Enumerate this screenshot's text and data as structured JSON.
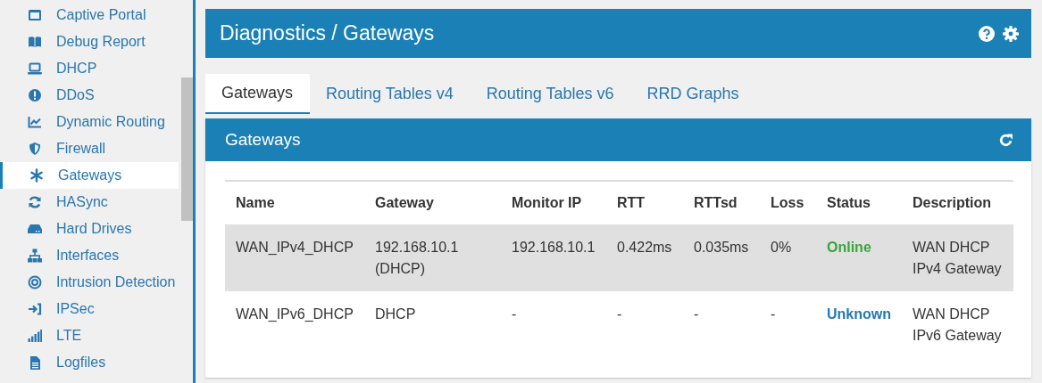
{
  "sidebar": {
    "items": [
      {
        "label": "Captive Portal",
        "selected": false
      },
      {
        "label": "Debug Report",
        "selected": false
      },
      {
        "label": "DHCP",
        "selected": false
      },
      {
        "label": "DDoS",
        "selected": false
      },
      {
        "label": "Dynamic Routing",
        "selected": false
      },
      {
        "label": "Firewall",
        "selected": false
      },
      {
        "label": "Gateways",
        "selected": true
      },
      {
        "label": "HASync",
        "selected": false
      },
      {
        "label": "Hard Drives",
        "selected": false
      },
      {
        "label": "Interfaces",
        "selected": false
      },
      {
        "label": "Intrusion Detection",
        "selected": false
      },
      {
        "label": "IPSec",
        "selected": false
      },
      {
        "label": "LTE",
        "selected": false
      },
      {
        "label": "Logfiles",
        "selected": false
      }
    ]
  },
  "page_header": {
    "title": "Diagnostics / Gateways"
  },
  "tabs": [
    {
      "label": "Gateways",
      "selected": true
    },
    {
      "label": "Routing Tables v4",
      "selected": false
    },
    {
      "label": "Routing Tables v6",
      "selected": false
    },
    {
      "label": "RRD Graphs",
      "selected": false
    }
  ],
  "panel": {
    "title": "Gateways",
    "table": {
      "columns": [
        "Name",
        "Gateway",
        "Monitor IP",
        "RTT",
        "RTTsd",
        "Loss",
        "Status",
        "Description"
      ],
      "rows": [
        {
          "highlighted": true,
          "cells": [
            "WAN_IPv4_DHCP",
            "192.168.10.1 (DHCP)",
            "192.168.10.1",
            "0.422ms",
            "0.035ms",
            "0%"
          ],
          "status": {
            "text": "Online",
            "color": "#3aa63a"
          },
          "description": "WAN DHCP IPv4 Gateway"
        },
        {
          "highlighted": false,
          "cells": [
            "WAN_IPv6_DHCP",
            "DHCP",
            "-",
            "-",
            "-",
            "-"
          ],
          "status": {
            "text": "Unknown",
            "color": "#2577b0"
          },
          "description": "WAN DHCP IPv6 Gateway"
        }
      ]
    }
  }
}
